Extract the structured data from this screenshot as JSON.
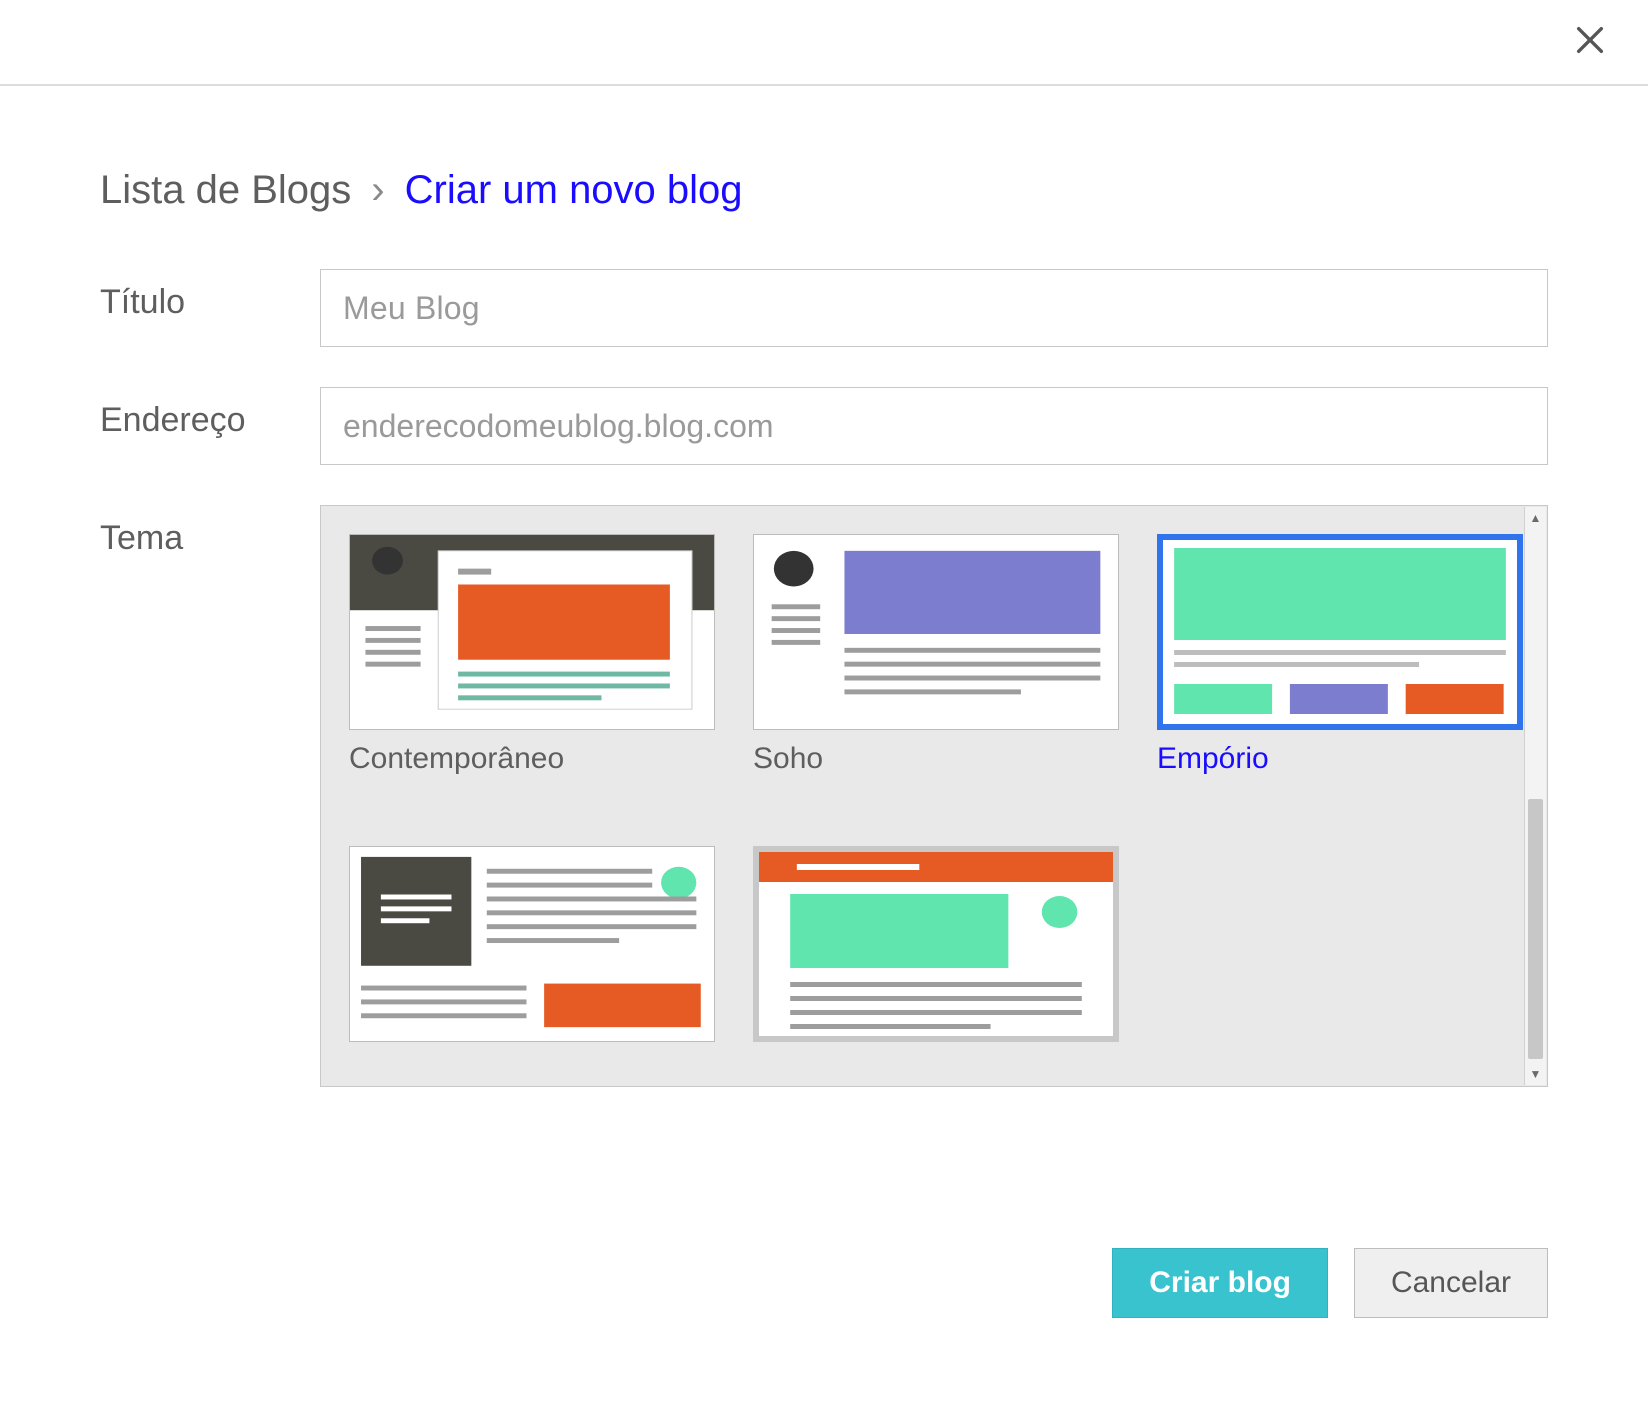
{
  "breadcrumb": {
    "root": "Lista de Blogs",
    "sep": "›",
    "current": "Criar um novo blog"
  },
  "form": {
    "title_label": "Título",
    "title_value": "Meu Blog",
    "address_label": "Endereço",
    "address_placeholder": "enderecodomeublog.blog.com",
    "theme_label": "Tema"
  },
  "themes": [
    {
      "name": "Contemporâneo",
      "selected": false
    },
    {
      "name": "Soho",
      "selected": false
    },
    {
      "name": "Empório",
      "selected": true
    },
    {
      "name": "",
      "selected": false
    },
    {
      "name": "",
      "selected": false
    }
  ],
  "actions": {
    "primary": "Criar blog",
    "secondary": "Cancelar"
  },
  "icons": {
    "close": "close-icon",
    "scroll_up": "▲",
    "scroll_down": "▼"
  }
}
